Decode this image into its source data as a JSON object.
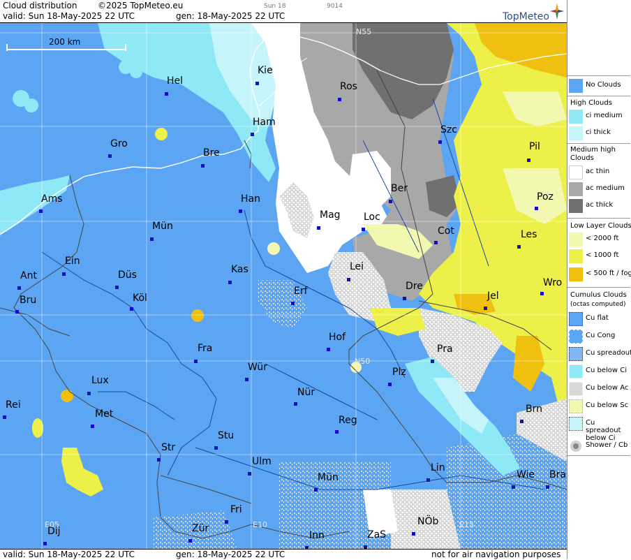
{
  "header": {
    "title": "Cloud distribution",
    "copyright": "©2025 TopMeteo.eu",
    "day_small": "Sun 18",
    "code_small": "9014",
    "valid": "valid:  Sun  18-May-2025  22 UTC",
    "gen": "gen: 18-May-2025 22 UTC",
    "brand": "TopMeteo"
  },
  "scale": {
    "label": "200 km"
  },
  "grid_labels": {
    "n55": "N55",
    "n50": "N50",
    "e05": "E05",
    "e10": "E10",
    "e15": "E15"
  },
  "cities": [
    {
      "name": "Kie"
    },
    {
      "name": "Hel"
    },
    {
      "name": "Ros"
    },
    {
      "name": "Ham"
    },
    {
      "name": "Szc"
    },
    {
      "name": "Gro"
    },
    {
      "name": "Bre"
    },
    {
      "name": "Pil"
    },
    {
      "name": "Ber"
    },
    {
      "name": "Ams"
    },
    {
      "name": "Han"
    },
    {
      "name": "Poz"
    },
    {
      "name": "Mag"
    },
    {
      "name": "Loc"
    },
    {
      "name": "Mün"
    },
    {
      "name": "Cot"
    },
    {
      "name": "Les"
    },
    {
      "name": "Ein"
    },
    {
      "name": "Kas"
    },
    {
      "name": "Lei"
    },
    {
      "name": "Ant"
    },
    {
      "name": "Düs"
    },
    {
      "name": "Wro"
    },
    {
      "name": "Dre"
    },
    {
      "name": "Erf"
    },
    {
      "name": "Bru"
    },
    {
      "name": "Köl"
    },
    {
      "name": "Jel"
    },
    {
      "name": "Hof"
    },
    {
      "name": "Fra"
    },
    {
      "name": "Pra"
    },
    {
      "name": "Wür"
    },
    {
      "name": "Lux"
    },
    {
      "name": "Plz"
    },
    {
      "name": "Nür"
    },
    {
      "name": "Rei"
    },
    {
      "name": "Met"
    },
    {
      "name": "Reg"
    },
    {
      "name": "Brn"
    },
    {
      "name": "Stu"
    },
    {
      "name": "Str"
    },
    {
      "name": "Ulm"
    },
    {
      "name": "Lin"
    },
    {
      "name": "Wie"
    },
    {
      "name": "Bra"
    },
    {
      "name": "Mün"
    },
    {
      "name": "Fri"
    },
    {
      "name": "NÖb"
    },
    {
      "name": "Dij"
    },
    {
      "name": "Zür"
    },
    {
      "name": "Inn"
    },
    {
      "name": "ZaS"
    }
  ],
  "footer": {
    "valid": "valid:  Sun  18-May-2025  22 UTC",
    "gen": "gen: 18-May-2025 22 UTC",
    "note": "not for air navigation purposes"
  },
  "legend": {
    "no_clouds": "No Clouds",
    "high_head": "High Clouds",
    "ci_medium": "ci medium",
    "ci_thick": "ci thick",
    "medium_head": "Medium high Clouds",
    "ac_thin": "ac thin",
    "ac_medium": "ac medium",
    "ac_thick": "ac thick",
    "low_head": "Low Layer Clouds",
    "low1": "< 2000 ft",
    "low2": "< 1000 ft",
    "low3": "< 500 ft / fog",
    "cu_head": "Cumulus Clouds",
    "cu_sub": "(octas computed)",
    "cu_flat": "Cu flat",
    "cu_cong": "Cu Cong",
    "cu_spread": "Cu spreadout",
    "cu_below_ci": "Cu below Ci",
    "cu_below_ac": "Cu below Ac",
    "cu_below_sc": "Cu below Sc",
    "cu_spread_ci": "Cu spreadout below Ci",
    "shower": "Shower / Cb"
  },
  "colors": {
    "no_clouds": "#5ca5f2",
    "ci_medium": "#8ee8f5",
    "ci_thick": "#c5f5fa",
    "ac_thin": "#ffffff",
    "ac_medium": "#a8a8a8",
    "ac_thick": "#707070",
    "low1": "#f2f8b0",
    "low2": "#eef04a",
    "low3": "#f0c010"
  }
}
